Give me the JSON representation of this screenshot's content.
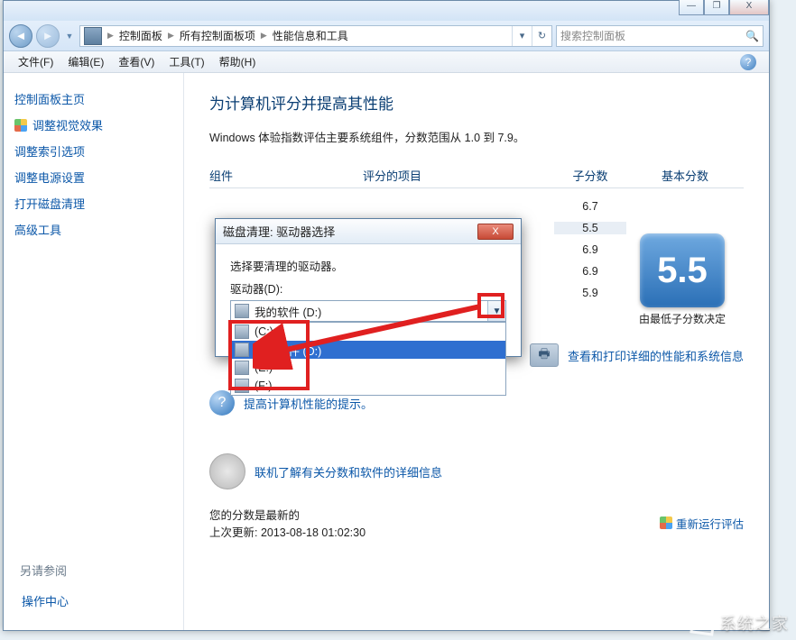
{
  "syscontrols": {
    "min": "—",
    "max": "❐",
    "close": "X"
  },
  "breadcrumb": {
    "items": [
      "控制面板",
      "所有控制面板项",
      "性能信息和工具"
    ]
  },
  "search": {
    "placeholder": "搜索控制面板"
  },
  "menu": {
    "file": "文件(F)",
    "edit": "编辑(E)",
    "view": "查看(V)",
    "tools": "工具(T)",
    "help": "帮助(H)"
  },
  "sidebar": {
    "items": [
      {
        "label": "控制面板主页",
        "shield": false
      },
      {
        "label": "调整视觉效果",
        "shield": true
      },
      {
        "label": "调整索引选项",
        "shield": false
      },
      {
        "label": "调整电源设置",
        "shield": false
      },
      {
        "label": "打开磁盘清理",
        "shield": false
      },
      {
        "label": "高级工具",
        "shield": false
      }
    ],
    "see_also_hdr": "另请参阅",
    "see_also": "操作中心"
  },
  "main": {
    "heading": "为计算机评分并提高其性能",
    "subtitle": "Windows 体验指数评估主要系统组件，分数范围从 1.0 到 7.9。",
    "cols": {
      "c1": "组件",
      "c2": "评分的项目",
      "c3": "子分数",
      "c4": "基本分数"
    },
    "scores": [
      "6.7",
      "5.5",
      "6.9",
      "6.9",
      "5.9"
    ],
    "big_score": "5.5",
    "big_caption": "由最低子分数决定",
    "link_print": "查看和打印详细的性能和系统信息",
    "link_tips": "提高计算机性能的提示。",
    "link_online": "联机了解有关分数和软件的详细信息",
    "footer_line1": "您的分数是最新的",
    "footer_line2_prefix": "上次更新: ",
    "footer_timestamp": "2013-08-18 01:02:30",
    "rerun": "重新运行评估"
  },
  "dialog": {
    "title": "磁盘清理: 驱动器选择",
    "prompt": "选择要清理的驱动器。",
    "label": "驱动器(D):",
    "selected": "我的软件  (D:)",
    "options": [
      {
        "label": "(C:)",
        "sel": false
      },
      {
        "label": "我的软件  (D:)",
        "sel": true
      },
      {
        "label": "(E:)",
        "sel": false
      },
      {
        "label": "(F:)",
        "sel": false
      }
    ]
  },
  "watermark": "系统之家"
}
